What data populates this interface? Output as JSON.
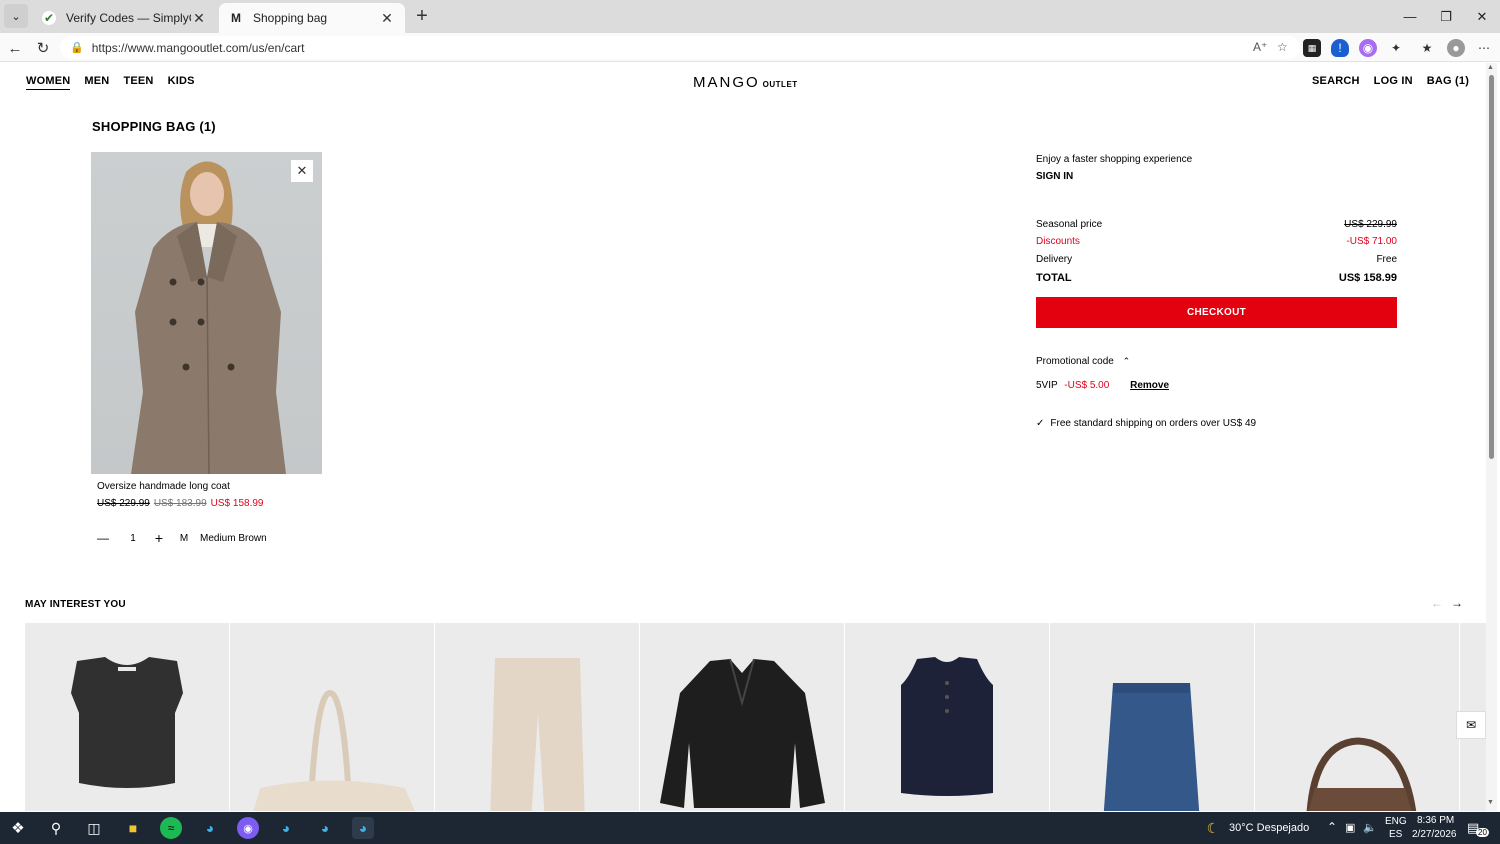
{
  "browser": {
    "tabs": [
      {
        "title": "Verify Codes — SimplyCodes",
        "icon": "check-leaf-icon"
      },
      {
        "title": "Shopping bag",
        "icon": "mango-m-icon"
      }
    ],
    "url": "https://www.mangooutlet.com/us/en/cart"
  },
  "site": {
    "nav_left": [
      "WOMEN",
      "MEN",
      "TEEN",
      "KIDS"
    ],
    "logo_main": "MANGO",
    "logo_sub": "OUTLET",
    "nav_right": [
      "SEARCH",
      "LOG IN",
      "BAG (1)"
    ]
  },
  "bag": {
    "title": "SHOPPING BAG (1)",
    "item": {
      "name": "Oversize handmade long coat",
      "price_original": "US$ 229.99",
      "price_outlet": "US$ 183.99",
      "price_final": "US$ 158.99",
      "qty": "1",
      "size": "M",
      "color": "Medium Brown"
    }
  },
  "summary": {
    "prompt": "Enjoy a faster shopping experience",
    "sign_in": "SIGN IN",
    "rows": [
      {
        "label": "Seasonal price",
        "value": "US$ 229.99"
      },
      {
        "label": "Discounts",
        "value": "-US$ 71.00"
      },
      {
        "label": "Delivery",
        "value": "Free"
      },
      {
        "label": "TOTAL",
        "value": "US$ 158.99"
      }
    ],
    "checkout": "CHECKOUT",
    "promo_label": "Promotional code",
    "promo_code": "5VIP",
    "promo_amount": "-US$ 5.00",
    "promo_remove": "Remove",
    "shipping_note": "Free standard shipping on orders over US$ 49"
  },
  "recommend": {
    "title": "MAY INTEREST YOU"
  },
  "taskbar": {
    "weather": "30°C  Despejado",
    "lang_top": "ENG",
    "lang_bottom": "ES",
    "time": "8:36 PM",
    "date": "2/27/2026",
    "notif_count": "20"
  }
}
